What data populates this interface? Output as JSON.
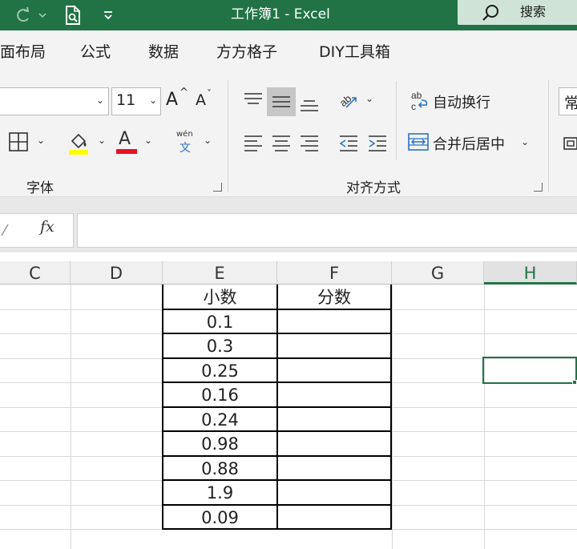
{
  "titlebar": {
    "title": "工作簿1  -  Excel",
    "search_label": "搜索",
    "icons": [
      "redo-icon",
      "dropdown-icon",
      "print-preview-icon",
      "customize-qat-icon",
      "search-icon"
    ]
  },
  "tabs": [
    "面布局",
    "公式",
    "数据",
    "方方格子",
    "DIY工具箱"
  ],
  "ribbon": {
    "font_group": {
      "label": "字体",
      "font_size": "11",
      "icons": [
        "increase-font-icon",
        "decrease-font-icon",
        "border-icon",
        "fill-color-icon",
        "font-color-icon",
        "phonetic-icon"
      ],
      "font_color_char": "A",
      "grow_char": "A",
      "shrink_char": "A",
      "phonetic_top": "wén",
      "phonetic_bottom": "文"
    },
    "align_group": {
      "label": "对齐方式",
      "wrap_text": "自动换行",
      "merge_center": "合并后居中",
      "icons": [
        "align-top-icon",
        "align-middle-icon",
        "align-bottom-icon",
        "orientation-icon",
        "align-left-icon",
        "align-center-icon",
        "align-right-icon",
        "decrease-indent-icon",
        "increase-indent-icon",
        "wrap-text-icon",
        "merge-center-icon"
      ]
    },
    "number_group_partial": "常"
  },
  "formula_bar": {
    "fx_label": "fx",
    "value": ""
  },
  "sheet": {
    "columns": [
      "C",
      "D",
      "E",
      "F",
      "G",
      "H"
    ],
    "selected_column": "H",
    "headers": {
      "E": "小数",
      "F": "分数"
    },
    "values_E": [
      "0.1",
      "0.3",
      "0.25",
      "0.16",
      "0.24",
      "0.98",
      "0.88",
      "1.9",
      "0.09"
    ],
    "values_F": [
      "",
      "",
      "",
      "",
      "",
      "",
      "",
      "",
      ""
    ]
  },
  "colors": {
    "excel_green": "#217346",
    "search_bg": "#cfe3d6",
    "ribbon_bg": "#f3f3f3",
    "fill_yellow": "#ffff00",
    "font_red": "#e81123",
    "accent_blue": "#2b73c4"
  }
}
